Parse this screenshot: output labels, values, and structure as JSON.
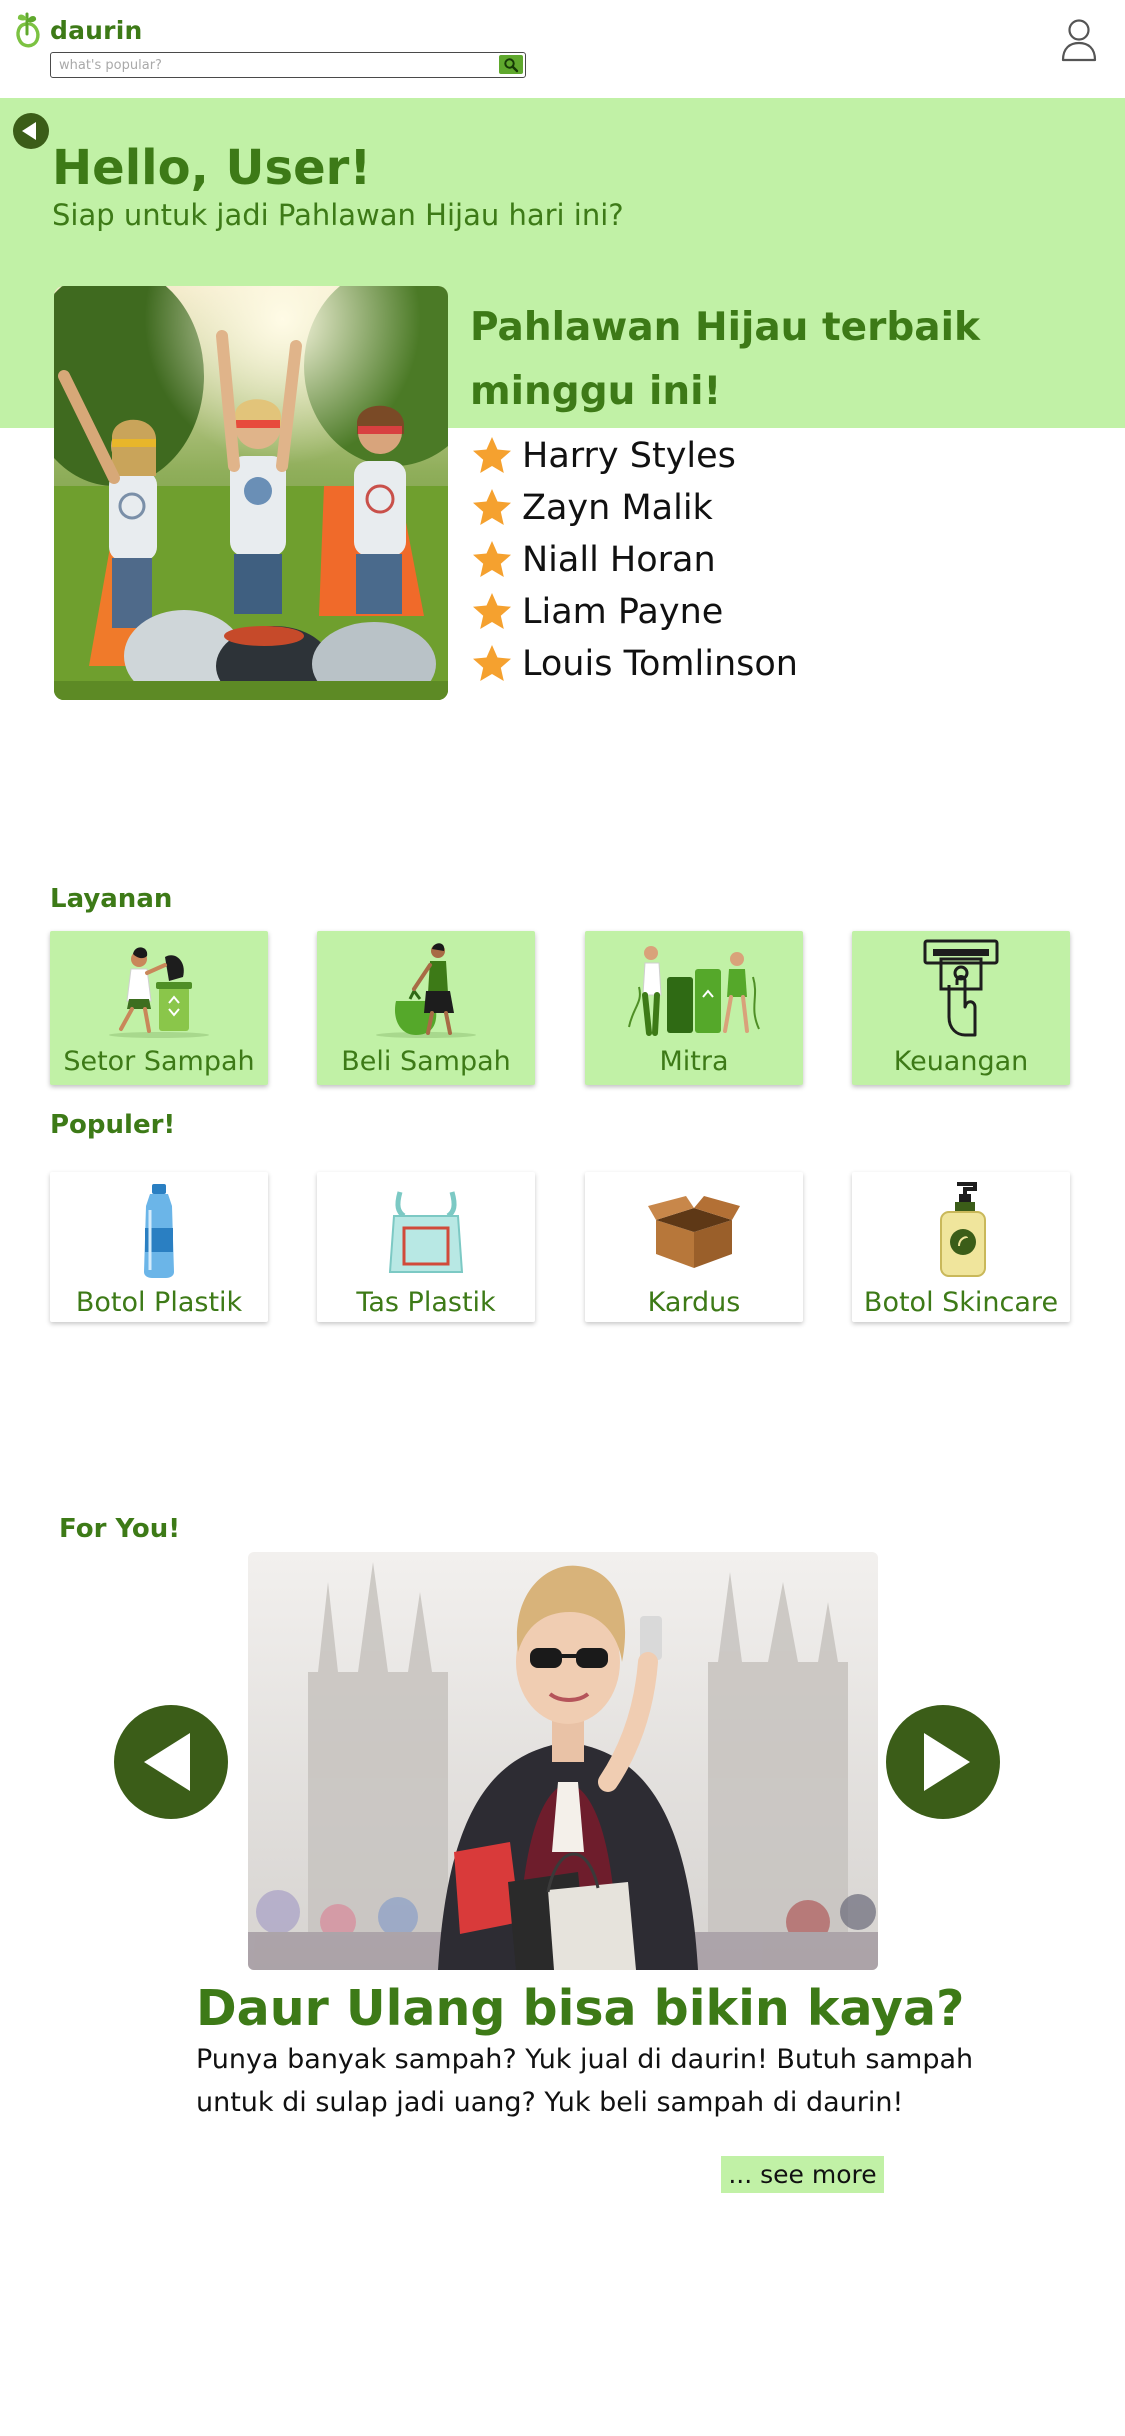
{
  "app": {
    "name": "daurin",
    "brand_color": "#3d7a17",
    "accent_color": "#c1f1a6",
    "dark_color": "#3b5d18"
  },
  "search": {
    "placeholder": "what's popular?"
  },
  "hero": {
    "greeting": "Hello, User!",
    "subtitle": "Siap untuk jadi Pahlawan Hijau hari ini?",
    "leaderboard_title": "Pahlawan Hijau terbaik minggu ini!",
    "leaders": [
      {
        "name": "Harry Styles",
        "icon": "star-icon"
      },
      {
        "name": "Zayn Malik",
        "icon": "star-icon"
      },
      {
        "name": "Niall Horan",
        "icon": "star-icon"
      },
      {
        "name": "Liam Payne",
        "icon": "star-icon"
      },
      {
        "name": "Louis Tomlinson",
        "icon": "star-icon"
      }
    ]
  },
  "services": {
    "title": "Layanan",
    "items": [
      {
        "label": "Setor Sampah",
        "icon": "deposit-trash-illustration"
      },
      {
        "label": "Beli Sampah",
        "icon": "buy-trash-illustration"
      },
      {
        "label": "Mitra",
        "icon": "partner-illustration"
      },
      {
        "label": "Keuangan",
        "icon": "atm-money-icon"
      }
    ]
  },
  "popular": {
    "title": "Populer!",
    "items": [
      {
        "label": "Botol Plastik",
        "icon": "plastic-bottle-icon"
      },
      {
        "label": "Tas Plastik",
        "icon": "plastic-bag-icon"
      },
      {
        "label": "Kardus",
        "icon": "cardboard-box-icon"
      },
      {
        "label": "Botol Skincare",
        "icon": "skincare-bottle-icon"
      }
    ]
  },
  "for_you": {
    "title": "For You!",
    "article_title": "Daur Ulang bisa bikin kaya?",
    "article_body": "Punya banyak sampah? Yuk jual di daurin! Butuh sampah untuk di sulap jadi uang? Yuk beli sampah di daurin!",
    "see_more": "... see more"
  }
}
